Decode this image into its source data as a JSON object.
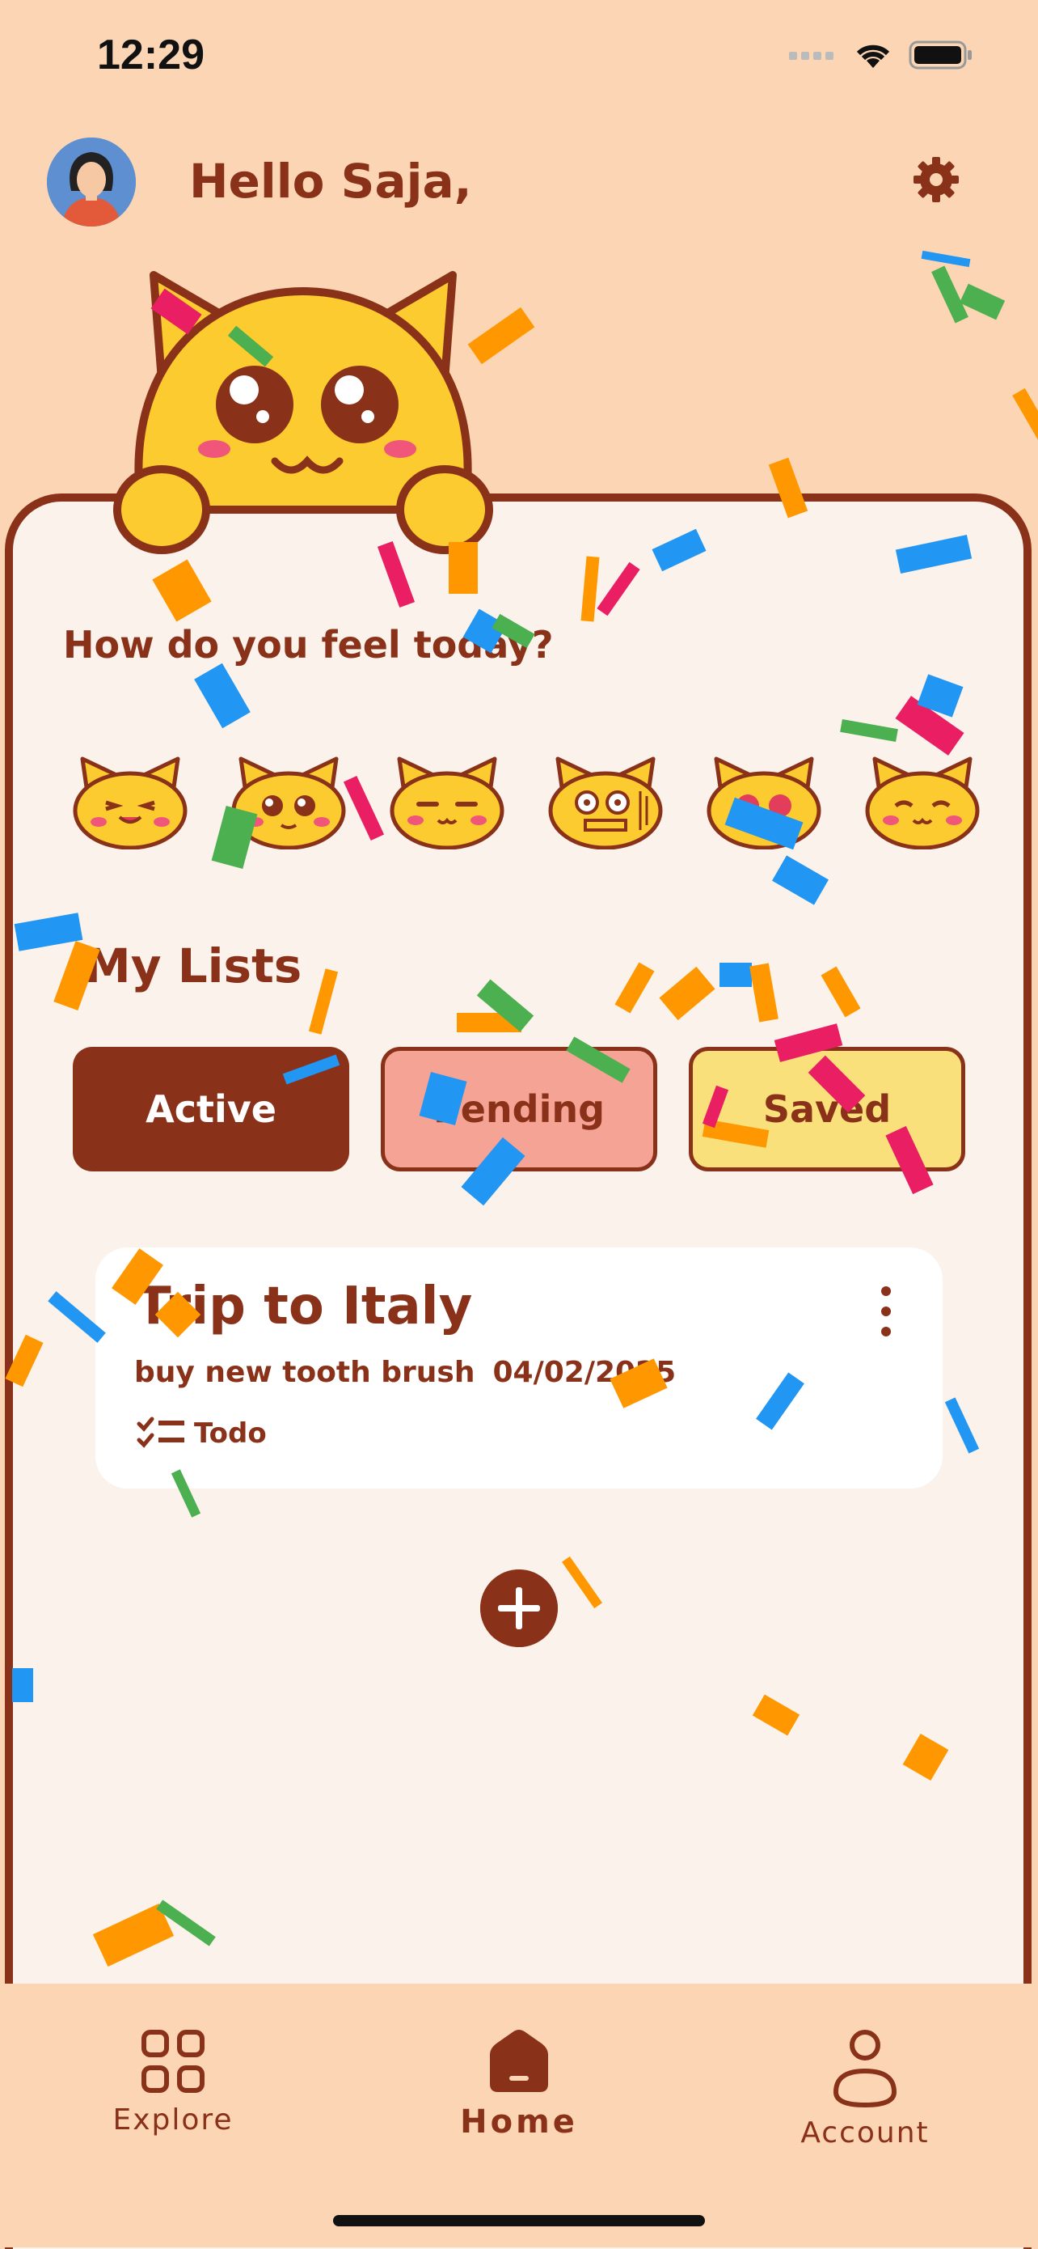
{
  "status_bar": {
    "time": "12:29"
  },
  "header": {
    "greeting": "Hello Saja,",
    "avatar_icon": "user-avatar-icon",
    "settings_icon": "gear-icon"
  },
  "mood": {
    "title": "How do you feel today?",
    "options": [
      "playful-cat-icon",
      "amazed-cat-icon",
      "unimpressed-cat-icon",
      "anxious-cat-icon",
      "blushing-cat-icon",
      "pleased-cat-icon"
    ]
  },
  "lists": {
    "title": "My Lists",
    "tabs": [
      {
        "label": "Active",
        "selected": true
      },
      {
        "label": "Pending",
        "selected": false
      },
      {
        "label": "Saved",
        "selected": false
      }
    ],
    "items": [
      {
        "title": "Trip to Italy",
        "task": "buy new tooth brush",
        "date": "04/02/2025",
        "tag": "Todo"
      }
    ]
  },
  "nav": {
    "items": [
      {
        "label": "Explore",
        "icon": "grid-icon"
      },
      {
        "label": "Home",
        "icon": "home-icon",
        "active": true
      },
      {
        "label": "Account",
        "icon": "person-icon"
      }
    ]
  },
  "colors": {
    "brown": "#8A3119",
    "peach": "#FCD6B4",
    "card": "#FBF2EB",
    "pending": "#F4A394",
    "saved": "#FAE07A",
    "cat": "#FCCB2F"
  }
}
